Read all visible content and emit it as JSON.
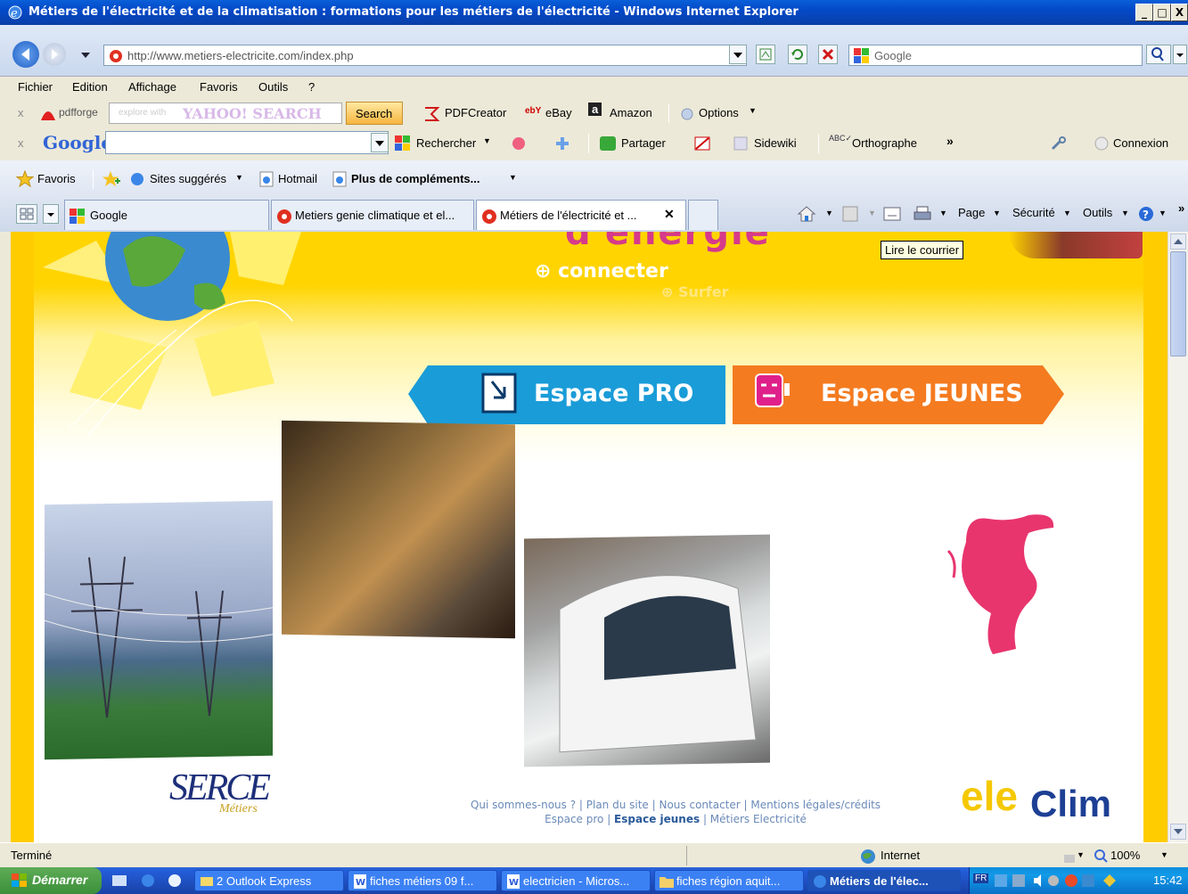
{
  "window": {
    "title": "Métiers de l'électricité et de la climatisation : formations pour les métiers de l'électricité  - Windows Internet Explorer",
    "min": "_",
    "max": "θ",
    "close": "X"
  },
  "address": {
    "url": "http://www.metiers-electricite.com/index.php",
    "search_placeholder": "Google"
  },
  "menu": [
    "Fichier",
    "Edition",
    "Affichage",
    "Favoris",
    "Outils",
    "?"
  ],
  "pdfforge_bar": {
    "brand": "pdfforge",
    "search_placeholder": "explore with",
    "yahoo": "YAHOO! SEARCH",
    "search_button": "Search",
    "items": [
      "PDFCreator",
      "eBay",
      "Amazon",
      "Options"
    ]
  },
  "google_bar": {
    "brand": "Google",
    "items": [
      "Rechercher",
      "Partager",
      "Sidewiki",
      "Orthographe",
      "Connexion"
    ]
  },
  "favorites_bar": {
    "items": [
      "Favoris",
      "Sites suggérés",
      "Hotmail",
      "Plus de compléments..."
    ]
  },
  "tabs": {
    "items": [
      "Google",
      "Metiers genie climatique et el...",
      "Métiers de l'électricité et ..."
    ],
    "commands": [
      "Page",
      "Sécurité",
      "Outils"
    ]
  },
  "tooltip": "Lire le courrier",
  "site": {
    "banner_partial": "d'énergie",
    "connect": "connecter",
    "surfer": "Surfer",
    "espace_pro": "Espace PRO",
    "espace_jeunes": "Espace JEUNES",
    "logo_serce": "SERCE",
    "logo_serce_sub": "Métiers",
    "logo_eleclim_1": "ele",
    "logo_eleclim_2": "Clim",
    "footer_line1": [
      "Qui sommes-nous ?",
      "Plan du site",
      "Nous contacter",
      "Mentions légales/crédits"
    ],
    "footer_line2": [
      "Espace pro",
      "Espace jeunes",
      "Métiers Electricité"
    ]
  },
  "status": {
    "text": "Terminé",
    "zone": "Internet",
    "zoom": "100%"
  },
  "taskbar": {
    "start": "Démarrer",
    "tasks": [
      "2 Outlook Express",
      "fiches métiers 09 f...",
      "electricien - Micros...",
      "fiches région aquit...",
      "Métiers de l'élec..."
    ],
    "clock": "15:42",
    "lang": "FR"
  },
  "colors": {
    "site_yellow": "#ffd400",
    "espace_pro_blue": "#1a9cd8",
    "espace_jeunes_orange": "#f47b20",
    "eleclim_blue": "#1d3f94"
  }
}
